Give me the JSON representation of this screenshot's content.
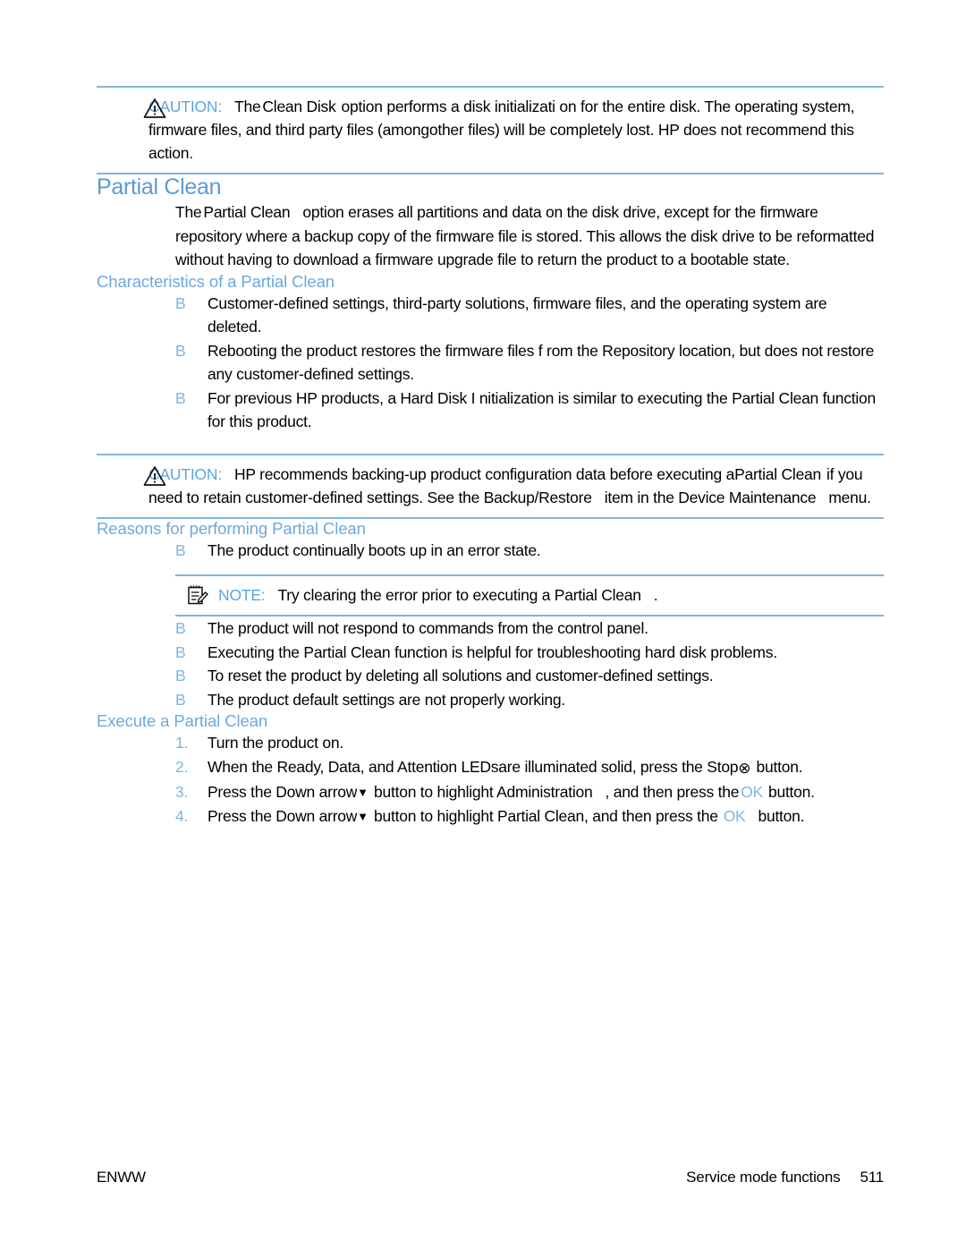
{
  "page": {
    "number": "511",
    "footer_left": "ENWW",
    "footer_right": "Service mode functions"
  },
  "caution_top": {
    "icon": "warning-triangle-icon",
    "label": "CAUTION:",
    "text_1": "The",
    "text_2": "Clean Disk",
    "text_3": "option performs a disk initializati on for the entire disk. The operating system, firmware files, and third party files (among",
    "text_4": "other files) will be completely lost. HP does not recommend this action."
  },
  "section": {
    "title": "Partial Clean",
    "intro_1": "The",
    "intro_2": "Partial Clean",
    "intro_3": "option erases all partitions and data on the disk drive, except for the firmware repository where a backup copy of the firmware file is stored. This allows the disk drive to be reformatted without having to download a firmware upgrade file to return the product to a bootable state."
  },
  "characteristics": {
    "heading": "Characteristics of a Partial Clean",
    "bullet_marker": "B",
    "items": [
      "Customer-defined settings, third-party solutions, firmware files, and the operating system are deleted.",
      "Rebooting the product restores the firmware files f rom the Repository location, but does not restore any customer-defined settings.",
      "For previous HP products, a Hard Disk I nitialization is similar to executing the Partial Clean function for this product."
    ]
  },
  "caution_mid": {
    "icon": "warning-triangle-icon",
    "label": "CAUTION:",
    "text_1": "HP recommends backing-up product configuration data before executing a",
    "text_2": "Partial Clean",
    "text_3": "if you need to retain customer-defined settings. See th",
    "text_4": "e Backup/Restore",
    "text_5": "item in the Device Maintenance",
    "text_6": "menu."
  },
  "reasons": {
    "heading": "Reasons for performing Partial Clean",
    "bullet_marker": "B",
    "item_first": "The product continually boots up in an error state.",
    "items_rest": [
      "The product will not respond to commands from the control panel.",
      "Executing the Partial Clean function is helpful for troubleshooting hard disk problems.",
      "To reset the product by deleting all solutions and customer-defined settings.",
      "The product default settings are not properly working."
    ]
  },
  "note": {
    "icon": "notepad-pencil-icon",
    "label": "NOTE:",
    "text": "Try clearing the error prior to executing a Partial Clean",
    "text_end": "."
  },
  "execute": {
    "heading": "Execute a Partial Clean",
    "steps": [
      {
        "number": "1.",
        "text": "Turn the product on."
      },
      {
        "number": "2.",
        "text_1": "When the Ready, Data, and Attention LEDs",
        "text_2": "are illuminated solid, press the Stop",
        "stop_glyph": "⊗",
        "text_3": "button."
      },
      {
        "number": "3.",
        "text_1": "Press the Down arrow",
        "arrow_glyph": "▼",
        "text_2": "button to highlight Administration",
        "text_3": ", and then press the",
        "ok_label": "OK",
        "text_4": "button."
      },
      {
        "number": "4.",
        "text_1": "Press the Down arrow",
        "arrow_glyph": "▼",
        "text_2": "button to highlight Partial Clean, and then press the",
        "ok_label": "OK",
        "text_3": "button."
      }
    ]
  },
  "colors": {
    "heading_blue": "#5b9bd5",
    "subheading_blue": "#6fa8dc",
    "accent_blue": "#7eb6e0",
    "rule_blue": "#7eb6e0",
    "text_black": "#000000"
  }
}
